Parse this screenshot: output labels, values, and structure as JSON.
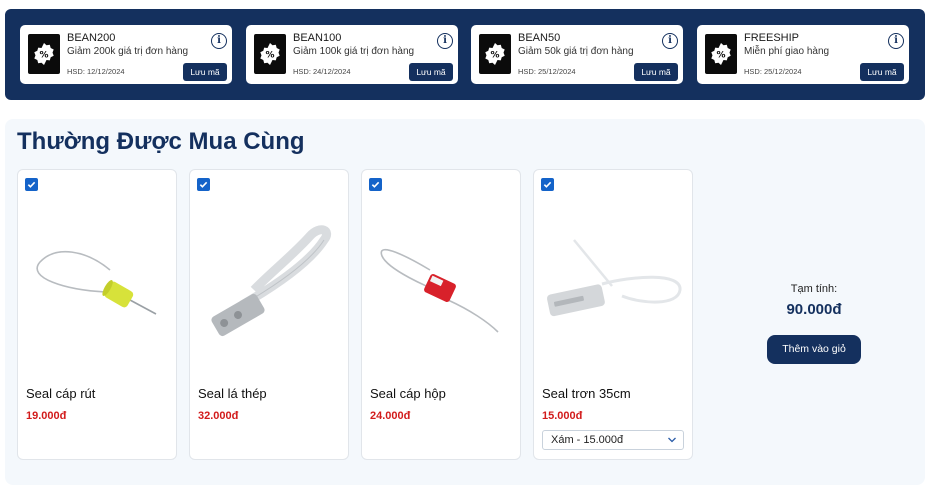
{
  "vouchers": [
    {
      "code": "BEAN200",
      "desc": "Giảm 200k giá trị đơn hàng",
      "expiry": "HSD: 12/12/2024",
      "save_label": "Lưu mã"
    },
    {
      "code": "BEAN100",
      "desc": "Giảm 100k giá trị đơn hàng",
      "expiry": "HSD: 24/12/2024",
      "save_label": "Lưu mã"
    },
    {
      "code": "BEAN50",
      "desc": "Giảm 50k giá trị đơn hàng",
      "expiry": "HSD: 25/12/2024",
      "save_label": "Lưu mã"
    },
    {
      "code": "FREESHIP",
      "desc": "Miễn phí giao hàng",
      "expiry": "HSD: 25/12/2024",
      "save_label": "Lưu mã"
    }
  ],
  "section": {
    "title": "Thường Được Mua Cùng"
  },
  "products": [
    {
      "name": "Seal cáp rút",
      "price": "19.000đ",
      "checked": true,
      "image": "cable-seal-yellow"
    },
    {
      "name": "Seal lá thép",
      "price": "32.000đ",
      "checked": true,
      "image": "steel-strap-seal"
    },
    {
      "name": "Seal cáp hộp",
      "price": "24.000đ",
      "checked": true,
      "image": "cable-seal-red-box"
    },
    {
      "name": "Seal trơn 35cm",
      "price": "15.000đ",
      "checked": true,
      "image": "plastic-pull-seal",
      "variant": "Xám - 15.000đ"
    }
  ],
  "summary": {
    "label": "Tạm tính:",
    "total": "90.000đ",
    "add_to_cart": "Thêm vào giỏ"
  },
  "colors": {
    "navy": "#14305e",
    "price_red": "#d21b1b",
    "checkbox_blue": "#1463c9"
  }
}
